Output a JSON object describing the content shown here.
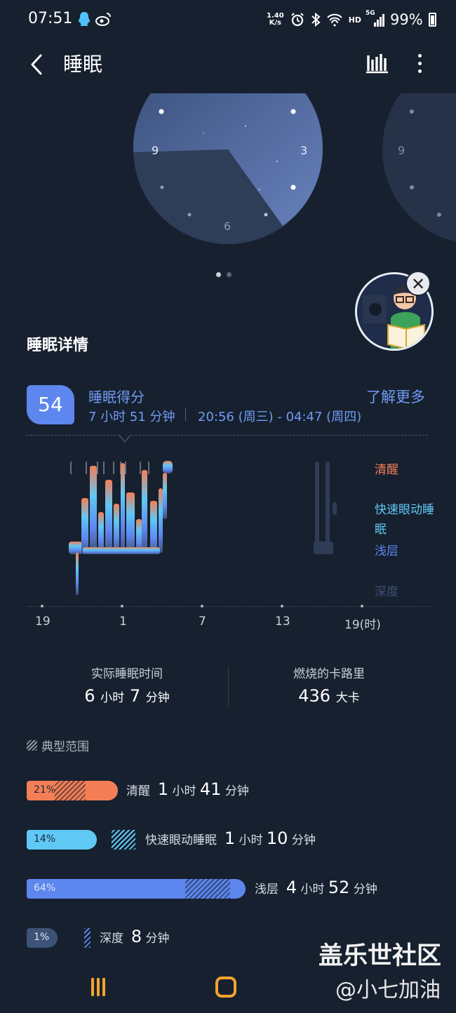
{
  "status_bar": {
    "time": "07:51",
    "net_speed_value": "1.40",
    "net_speed_unit": "K/s",
    "hd_label": "HD",
    "signal_label": "5G",
    "battery": "99%"
  },
  "header": {
    "title": "睡眠"
  },
  "dial": {
    "hour_labels": [
      "9",
      "3",
      "6"
    ],
    "carousel_page": 1,
    "carousel_total": 2
  },
  "details": {
    "section_title": "睡眠详情",
    "score": "54",
    "score_label": "睡眠得分",
    "duration": "7 小时 51 分钟",
    "range": "20:56 (周三) - 04:47 (周四)",
    "learn_more": "了解更多"
  },
  "hypnogram": {
    "stage_labels": {
      "awake": "清醒",
      "rem": "快速眼动睡眠",
      "light": "浅层",
      "deep": "深度"
    },
    "x_ticks": [
      "19",
      "1",
      "7",
      "13",
      "19(时)"
    ]
  },
  "stats": {
    "actual_sleep_title": "实际睡眠时间",
    "actual_sleep_hours": "6",
    "actual_sleep_minutes": "7",
    "calories_title": "燃烧的卡路里",
    "calories_value": "436",
    "calories_unit": "大卡",
    "unit_hour": "小时",
    "unit_minute": "分钟"
  },
  "typical_range_label": "典型范围",
  "stages": [
    {
      "name": "清醒",
      "percent": "21%",
      "hours": "1",
      "minutes": "41",
      "color": "#f47f56",
      "fraction": 0.21
    },
    {
      "name": "快速眼动睡眠",
      "percent": "14%",
      "hours": "1",
      "minutes": "10",
      "color": "#5fc8f4",
      "fraction": 0.14
    },
    {
      "name": "浅层",
      "percent": "64%",
      "hours": "4",
      "minutes": "52",
      "color": "#5d86ee",
      "fraction": 0.64
    },
    {
      "name": "深度",
      "percent": "1%",
      "minutes": "8",
      "color": "#3d5277",
      "fraction": 0.01
    }
  ],
  "watermark": {
    "line1": "盖乐世社区",
    "line2": "@小七加油"
  }
}
